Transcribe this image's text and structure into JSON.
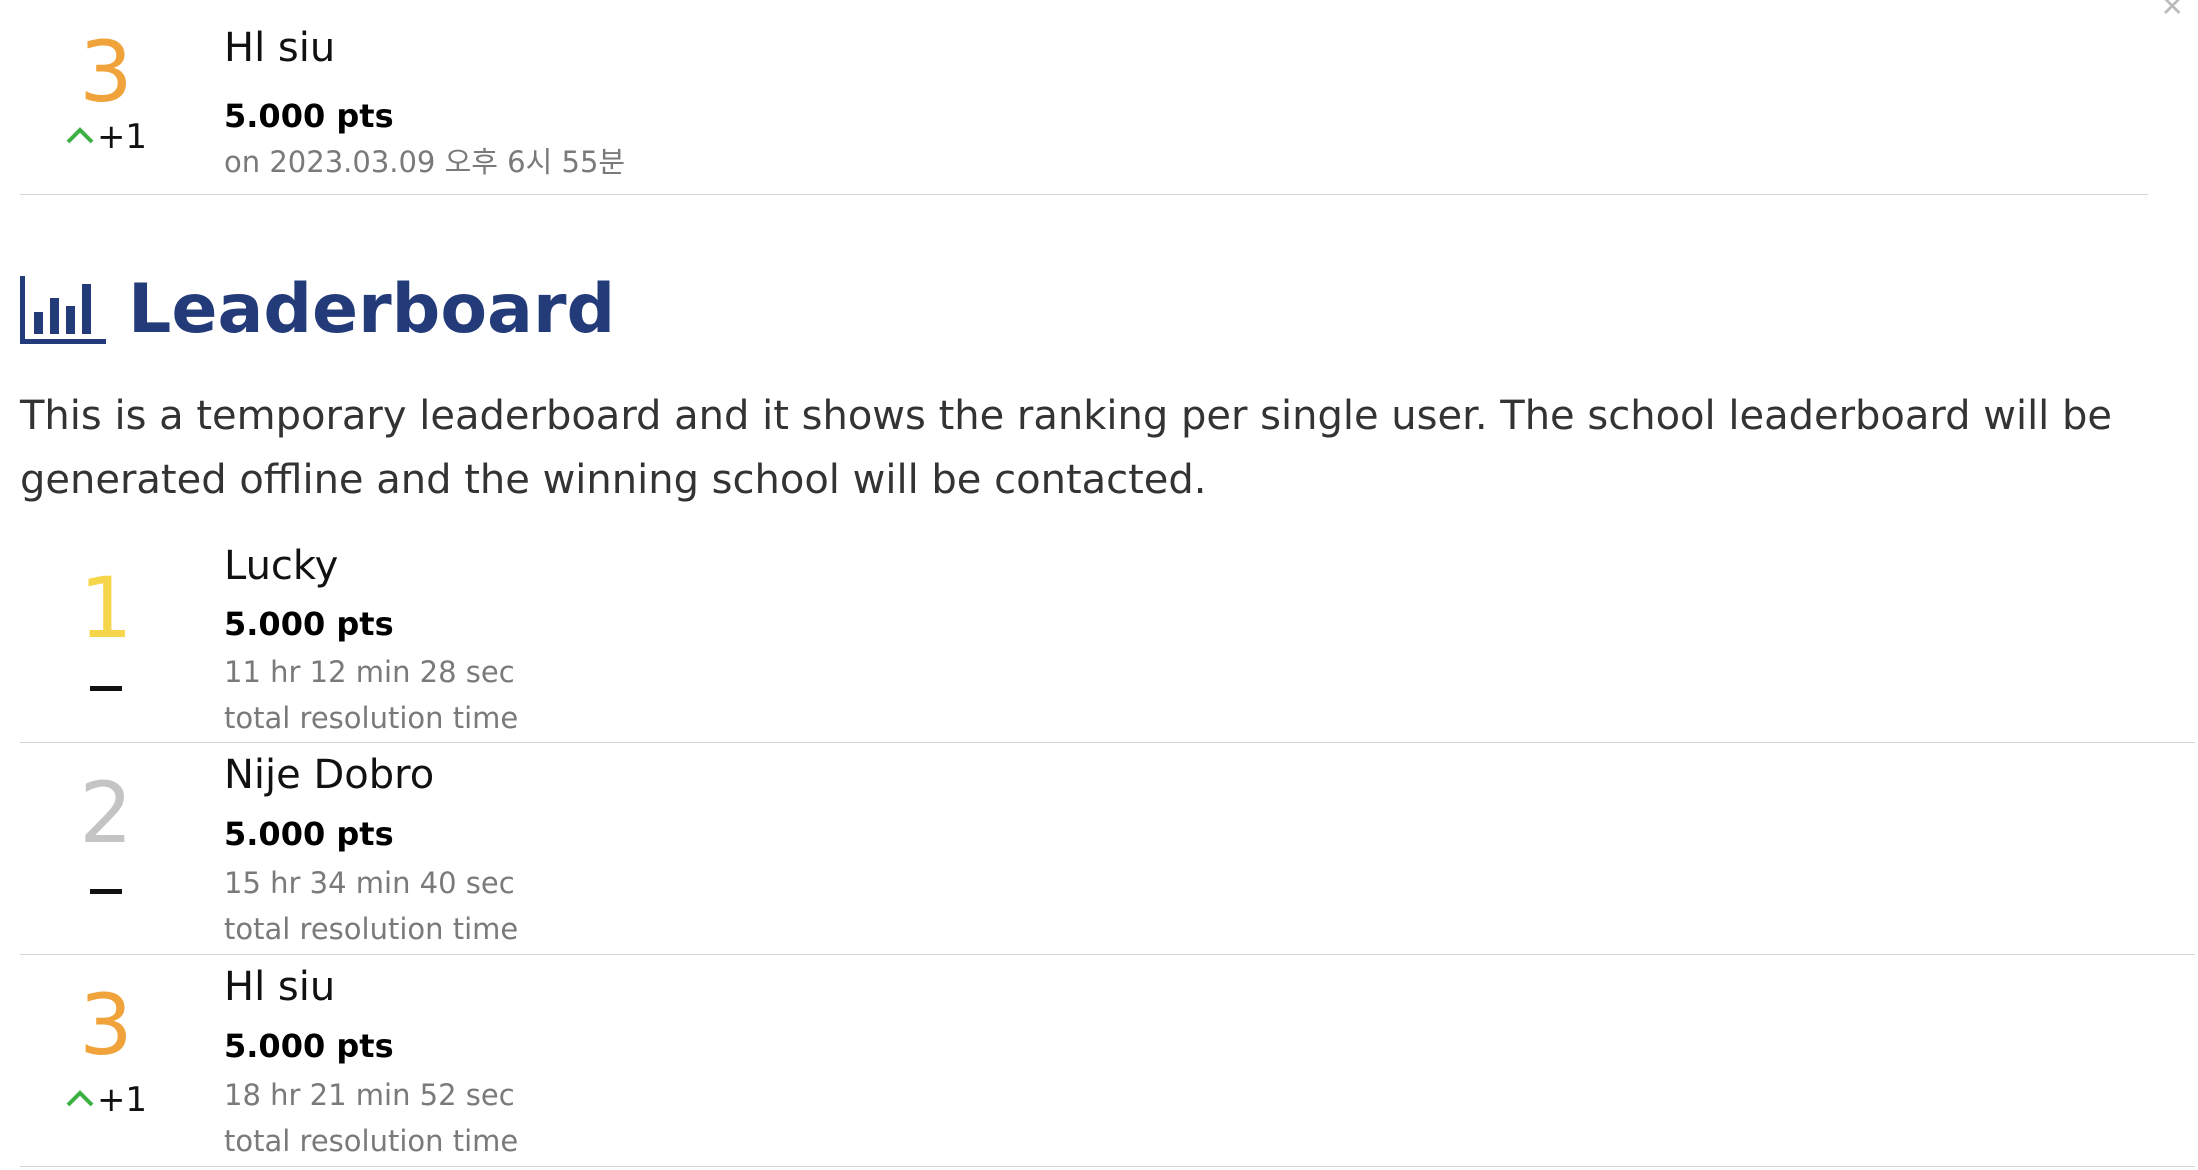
{
  "top_entry": {
    "rank": "3",
    "change": "+1",
    "name": "Hl siu",
    "points": "5.000 pts",
    "date": "on 2023.03.09 오후 6시 55분"
  },
  "leaderboard": {
    "title": "Leaderboard",
    "icon": "bar-chart-icon",
    "description": "This is a temporary leaderboard and it shows the ranking per single user. The school leaderboard will be generated offline and the winning school will be contacted.",
    "entries": [
      {
        "rank": "1",
        "change_type": "none",
        "name": "Lucky",
        "points": "5.000 pts",
        "time": "11 hr 12 min 28 sec",
        "time_label": "total resolution time"
      },
      {
        "rank": "2",
        "change_type": "none",
        "name": "Nije Dobro",
        "points": "5.000 pts",
        "time": "15 hr 34 min 40 sec",
        "time_label": "total resolution time"
      },
      {
        "rank": "3",
        "change_type": "up",
        "change": "+1",
        "name": "Hl siu",
        "points": "5.000 pts",
        "time": "18 hr 21 min 52 sec",
        "time_label": "total resolution time"
      }
    ]
  },
  "colors": {
    "heading": "#243b7a",
    "gold": "#f5d64a",
    "silver": "#c4c4c4",
    "bronze": "#f0a33a",
    "up_arrow": "#3cb043"
  }
}
